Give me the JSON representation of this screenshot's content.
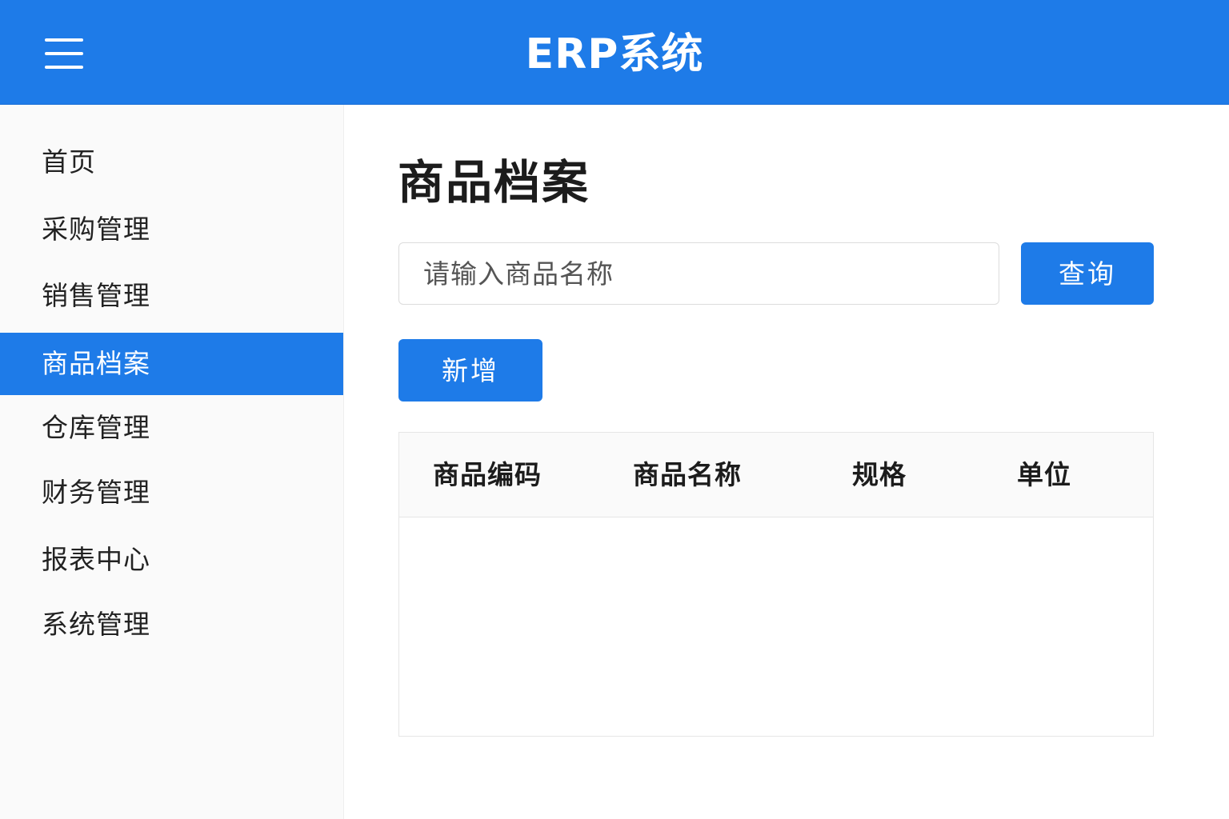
{
  "header": {
    "title": "ERP系统",
    "menu_icon": "hamburger-menu-icon",
    "background_color": "#1e7be8"
  },
  "sidebar": {
    "items": [
      {
        "label": "首页",
        "active": false
      },
      {
        "label": "采购管理",
        "active": false
      },
      {
        "label": "销售管理",
        "active": false
      },
      {
        "label": "商品档案",
        "active": true
      },
      {
        "label": "仓库管理",
        "active": false
      },
      {
        "label": "财务管理",
        "active": false
      },
      {
        "label": "报表中心",
        "active": false
      },
      {
        "label": "系统管理",
        "active": false
      }
    ],
    "active_color": "#1e7be8"
  },
  "main": {
    "page_title": "商品档案",
    "search": {
      "placeholder": "请输入商品名称",
      "value": ""
    },
    "query_button": "查询",
    "add_button": "新增",
    "table": {
      "columns": [
        "商品编码",
        "商品名称",
        "规格",
        "单位"
      ],
      "rows": []
    }
  }
}
